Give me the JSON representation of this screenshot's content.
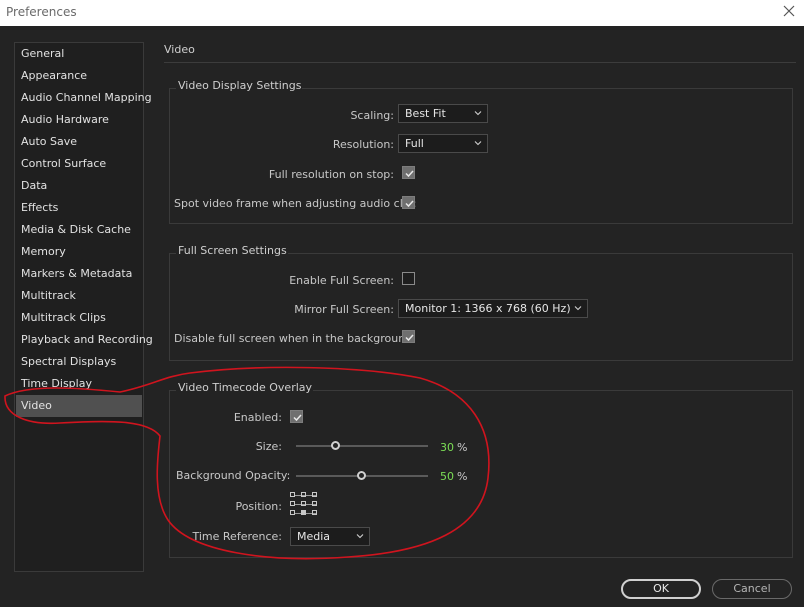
{
  "window": {
    "title": "Preferences"
  },
  "sidebar": {
    "items": [
      {
        "label": "General"
      },
      {
        "label": "Appearance"
      },
      {
        "label": "Audio Channel Mapping"
      },
      {
        "label": "Audio Hardware"
      },
      {
        "label": "Auto Save"
      },
      {
        "label": "Control Surface"
      },
      {
        "label": "Data"
      },
      {
        "label": "Effects"
      },
      {
        "label": "Media & Disk Cache"
      },
      {
        "label": "Memory"
      },
      {
        "label": "Markers & Metadata"
      },
      {
        "label": "Multitrack"
      },
      {
        "label": "Multitrack Clips"
      },
      {
        "label": "Playback and Recording"
      },
      {
        "label": "Spectral Displays"
      },
      {
        "label": "Time Display"
      },
      {
        "label": "Video",
        "selected": true
      }
    ]
  },
  "panel": {
    "title": "Video"
  },
  "video_display": {
    "legend": "Video Display Settings",
    "scaling_label": "Scaling:",
    "scaling_value": "Best Fit",
    "resolution_label": "Resolution:",
    "resolution_value": "Full",
    "full_res_stop_label": "Full resolution on stop:",
    "full_res_stop_checked": true,
    "spot_frame_label": "Spot video frame when adjusting audio clip:",
    "spot_frame_checked": true
  },
  "full_screen": {
    "legend": "Full Screen Settings",
    "enable_label": "Enable Full Screen:",
    "enable_checked": false,
    "mirror_label": "Mirror Full Screen:",
    "mirror_value": "Monitor 1: 1366 x 768 (60 Hz)",
    "disable_bg_label": "Disable full screen when in the background:",
    "disable_bg_checked": true
  },
  "timecode_overlay": {
    "legend": "Video Timecode Overlay",
    "enabled_label": "Enabled:",
    "enabled_checked": true,
    "size_label": "Size:",
    "size_value": "30",
    "bg_opacity_label": "Background Opacity:",
    "bg_opacity_value": "50",
    "percent_unit": "%",
    "position_label": "Position:",
    "position_selected": "bottom-center",
    "time_reference_label": "Time Reference:",
    "time_reference_value": "Media"
  },
  "footer": {
    "ok_label": "OK",
    "cancel_label": "Cancel"
  },
  "colors": {
    "accent_value": "#7bdc55",
    "annotation": "#d0141e",
    "selected_item": "#505050"
  },
  "icons": {
    "close": "close-icon",
    "dropdown": "chevron-down-icon",
    "check": "checkmark-icon"
  }
}
